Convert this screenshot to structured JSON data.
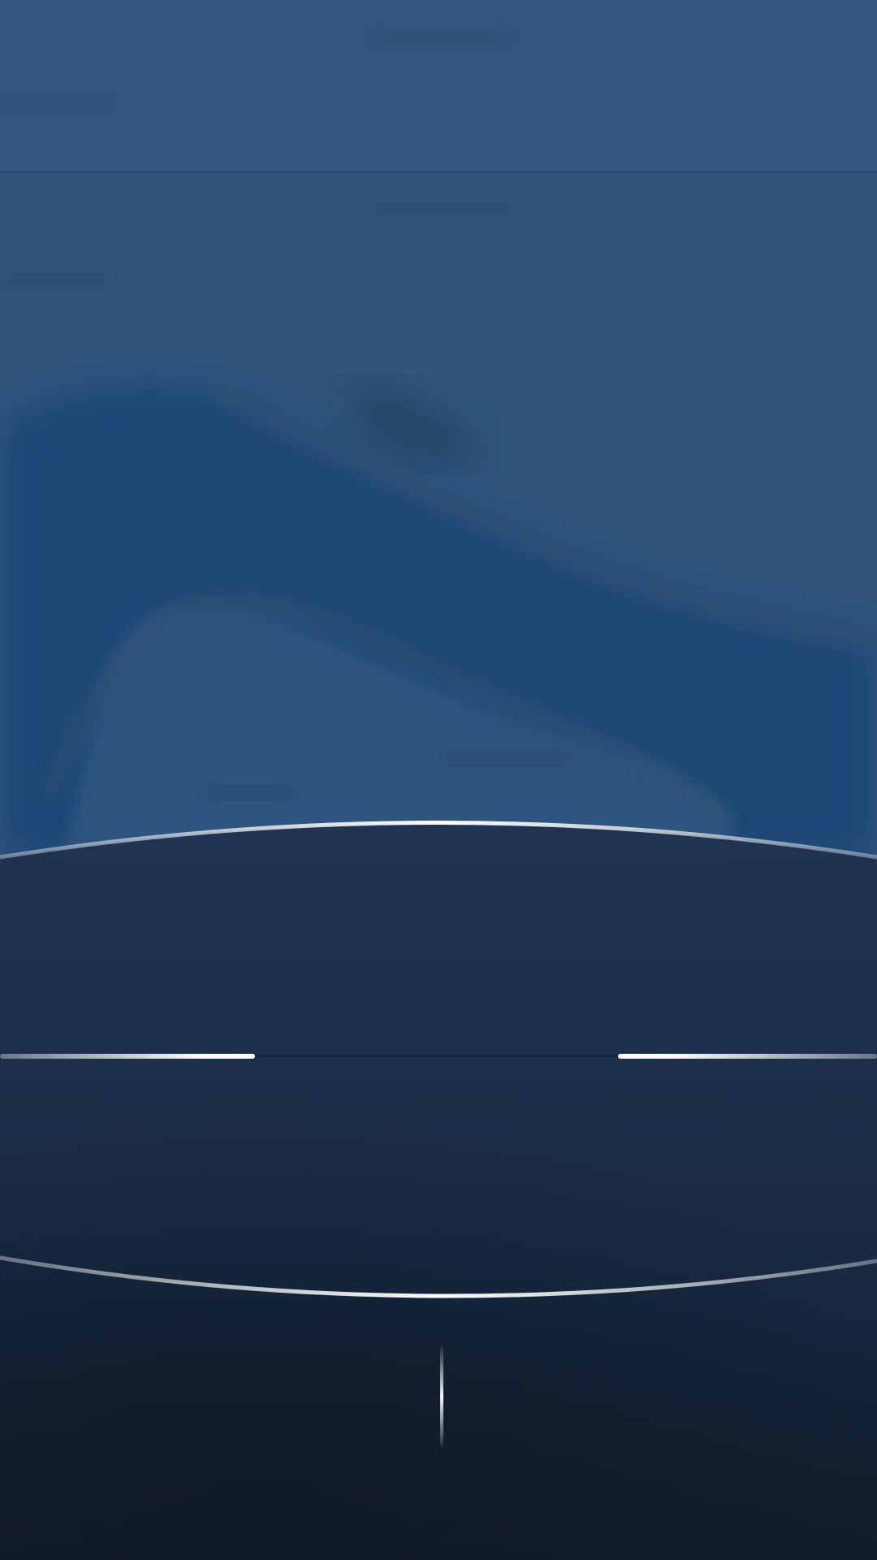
{
  "screen": {
    "description": "",
    "colors": {
      "backdrop": "#31557d",
      "water": "#1e4677",
      "overlay_top": "#1f3350",
      "overlay_bottom": "#101c2b",
      "guide_line": "#ffffff"
    }
  },
  "overlay": {
    "icons": [
      "guide-line-icon",
      "handle-icon"
    ]
  }
}
